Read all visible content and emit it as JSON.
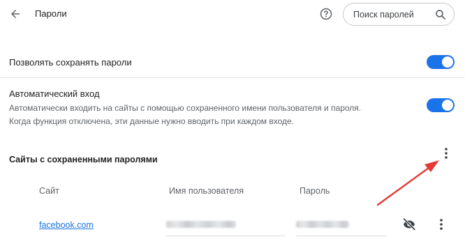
{
  "header": {
    "title": "Пароли",
    "back_icon": "arrow-left-icon",
    "help_icon": "help-circle-icon",
    "search": {
      "placeholder": "Поиск паролей",
      "value": "",
      "icon": "search-icon"
    }
  },
  "settings": {
    "offer_to_save": {
      "label": "Позволять сохранять пароли",
      "enabled": true
    },
    "auto_signin": {
      "label": "Автоматический вход",
      "description_line1": "Автоматически входить на сайты с помощью сохраненного имени пользователя и пароля.",
      "description_line2": "Когда функция отключена, эти данные нужно вводить при каждом входе.",
      "enabled": true
    }
  },
  "saved_passwords": {
    "title": "Сайты с сохраненными паролями",
    "columns": {
      "site": "Сайт",
      "username": "Имя пользователя",
      "password": "Пароль"
    },
    "rows": [
      {
        "site": "facebook.com",
        "username": "",
        "password": ""
      }
    ]
  },
  "colors": {
    "accent": "#1a73e8",
    "annotation_arrow": "#e53935",
    "text_primary": "#202124",
    "text_secondary": "#5f6368"
  }
}
